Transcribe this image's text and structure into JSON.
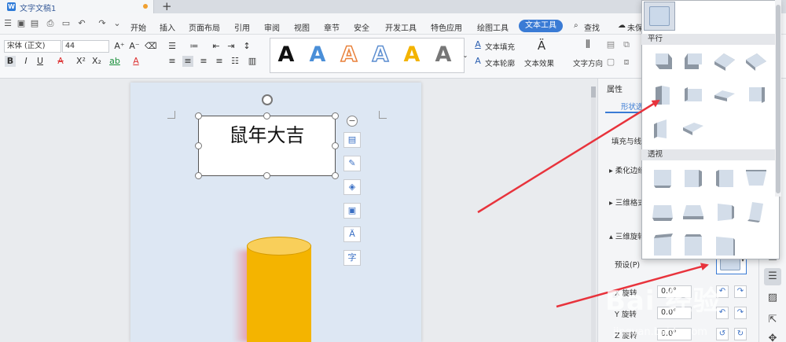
{
  "window": {
    "doc_title": "文字文稿1",
    "new_tab": "+"
  },
  "menu": {
    "items": [
      "开始",
      "插入",
      "页面布局",
      "引用",
      "审阅",
      "视图",
      "章节",
      "安全",
      "开发工具",
      "特色应用",
      "绘图工具"
    ],
    "active": "文本工具",
    "search": "查找",
    "unsaved": "未保"
  },
  "ribbon": {
    "font_name": "宋体 (正文)",
    "font_size": "44",
    "text_fill": "文本填充",
    "text_outline": "文本轮廓",
    "text_effect": "文本效果",
    "text_direction": "文字方向",
    "style_glyph": "A"
  },
  "document": {
    "textbox_text": "鼠年大吉"
  },
  "properties": {
    "title": "属性",
    "tab_shape": "形状选",
    "fill_line": "填充与线条",
    "soft_edge": "柔化边缘",
    "format_3d": "三维格式",
    "rotation_3d": "三维旋转",
    "preset_label": "预设(P)",
    "x_rotation_label": "X 旋转",
    "x_rotation_value": "0.0°",
    "y_rotation_label": "Y 旋转",
    "y_rotation_value": "0.0°",
    "z_rotation_label": "Z 旋转",
    "z_rotation_value": "0.0°"
  },
  "dropdown": {
    "section_parallel": "平行",
    "section_perspective": "透视"
  },
  "watermark": {
    "main": "Bai 经验",
    "sub": "jingyan.baidu.com"
  },
  "colors": {
    "accent": "#3a7bd5",
    "arrow": "#e8333c",
    "cylinder": "#f4b400"
  }
}
